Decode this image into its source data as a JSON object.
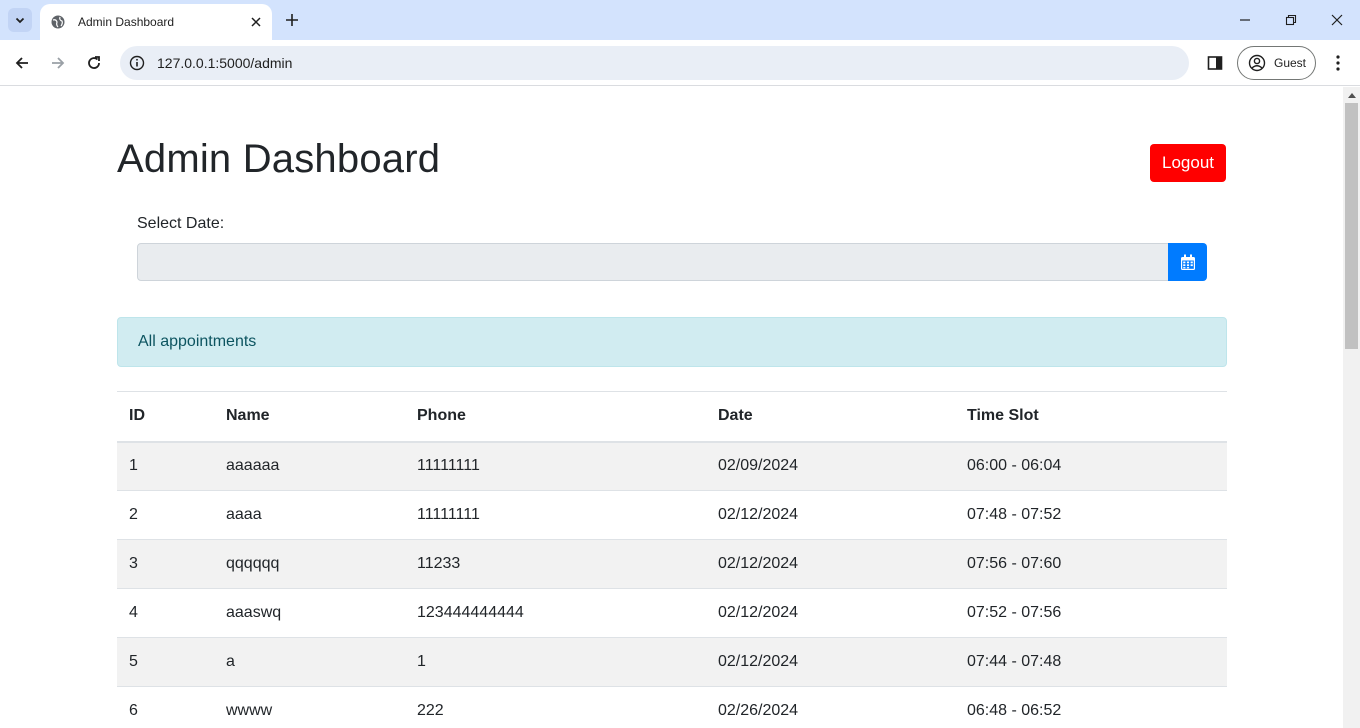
{
  "browser": {
    "tab_title": "Admin Dashboard",
    "url": "127.0.0.1:5000/admin",
    "profile_label": "Guest"
  },
  "page": {
    "title": "Admin Dashboard",
    "logout_label": "Logout",
    "date_label": "Select Date:",
    "date_value": "",
    "alert_text": "All appointments"
  },
  "table": {
    "headers": [
      "ID",
      "Name",
      "Phone",
      "Date",
      "Time Slot"
    ],
    "rows": [
      [
        "1",
        "aaaaaa",
        "11111111",
        "02/09/2024",
        "06:00 - 06:04"
      ],
      [
        "2",
        "aaaa",
        "11111111",
        "02/12/2024",
        "07:48 - 07:52"
      ],
      [
        "3",
        "qqqqqq",
        "11233",
        "02/12/2024",
        "07:56 - 07:60"
      ],
      [
        "4",
        "aaaswq",
        "123444444444",
        "02/12/2024",
        "07:52 - 07:56"
      ],
      [
        "5",
        "a",
        "1",
        "02/12/2024",
        "07:44 - 07:48"
      ],
      [
        "6",
        "wwww",
        "222",
        "02/26/2024",
        "06:48 - 06:52"
      ]
    ]
  },
  "colors": {
    "logout_bg": "#ff0000",
    "calendar_btn_bg": "#007bff",
    "alert_bg": "#d1ecf1",
    "alert_text": "#0c5460",
    "tabbar_bg": "#d3e3fd"
  }
}
